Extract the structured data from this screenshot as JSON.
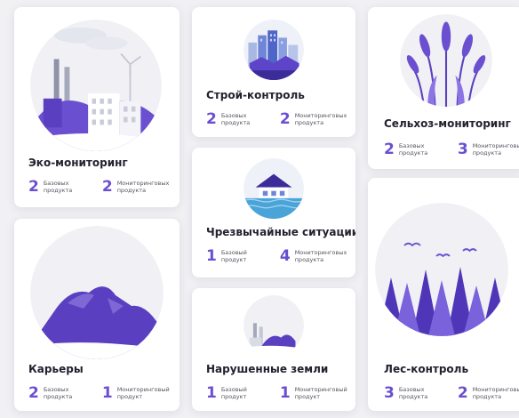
{
  "colors": {
    "accent": "#6a4fd1",
    "card": "#ffffff",
    "page": "#f1f1f4"
  },
  "cards": {
    "eco": {
      "title": "Эко-мониторинг",
      "icon": "factory-icon",
      "stats": [
        {
          "num": "2",
          "label": "Базовых продукта"
        },
        {
          "num": "2",
          "label": "Мониторинговых продукта"
        }
      ]
    },
    "stroy": {
      "title": "Строй-контроль",
      "icon": "city-buildings-icon",
      "stats": [
        {
          "num": "2",
          "label": "Базовых продукта"
        },
        {
          "num": "2",
          "label": "Мониторинговых продукта"
        }
      ]
    },
    "selhoz": {
      "title": "Сельхоз-мониторинг",
      "icon": "wheat-icon",
      "stats": [
        {
          "num": "2",
          "label": "Базовых продукта"
        },
        {
          "num": "3",
          "label": "Мониторинговых продукта"
        }
      ]
    },
    "emerg": {
      "title": "Чрезвычайные ситуации",
      "icon": "flooded-house-icon",
      "stats": [
        {
          "num": "1",
          "label": "Базовый продукт"
        },
        {
          "num": "4",
          "label": "Мониторинговых продукта"
        }
      ]
    },
    "quarry": {
      "title": "Карьеры",
      "icon": "mountains-icon",
      "stats": [
        {
          "num": "2",
          "label": "Базовых продукта"
        },
        {
          "num": "1",
          "label": "Мониторинговый продукт"
        }
      ]
    },
    "damaged": {
      "title": "Нарушенные земли",
      "icon": "damaged-land-icon",
      "stats": [
        {
          "num": "1",
          "label": "Базовый продукт"
        },
        {
          "num": "1",
          "label": "Мониторинговый продукт"
        }
      ]
    },
    "forest": {
      "title": "Лес-контроль",
      "icon": "forest-icon",
      "stats": [
        {
          "num": "3",
          "label": "Базовых продукта"
        },
        {
          "num": "2",
          "label": "Мониторинговых продукта"
        }
      ]
    }
  }
}
